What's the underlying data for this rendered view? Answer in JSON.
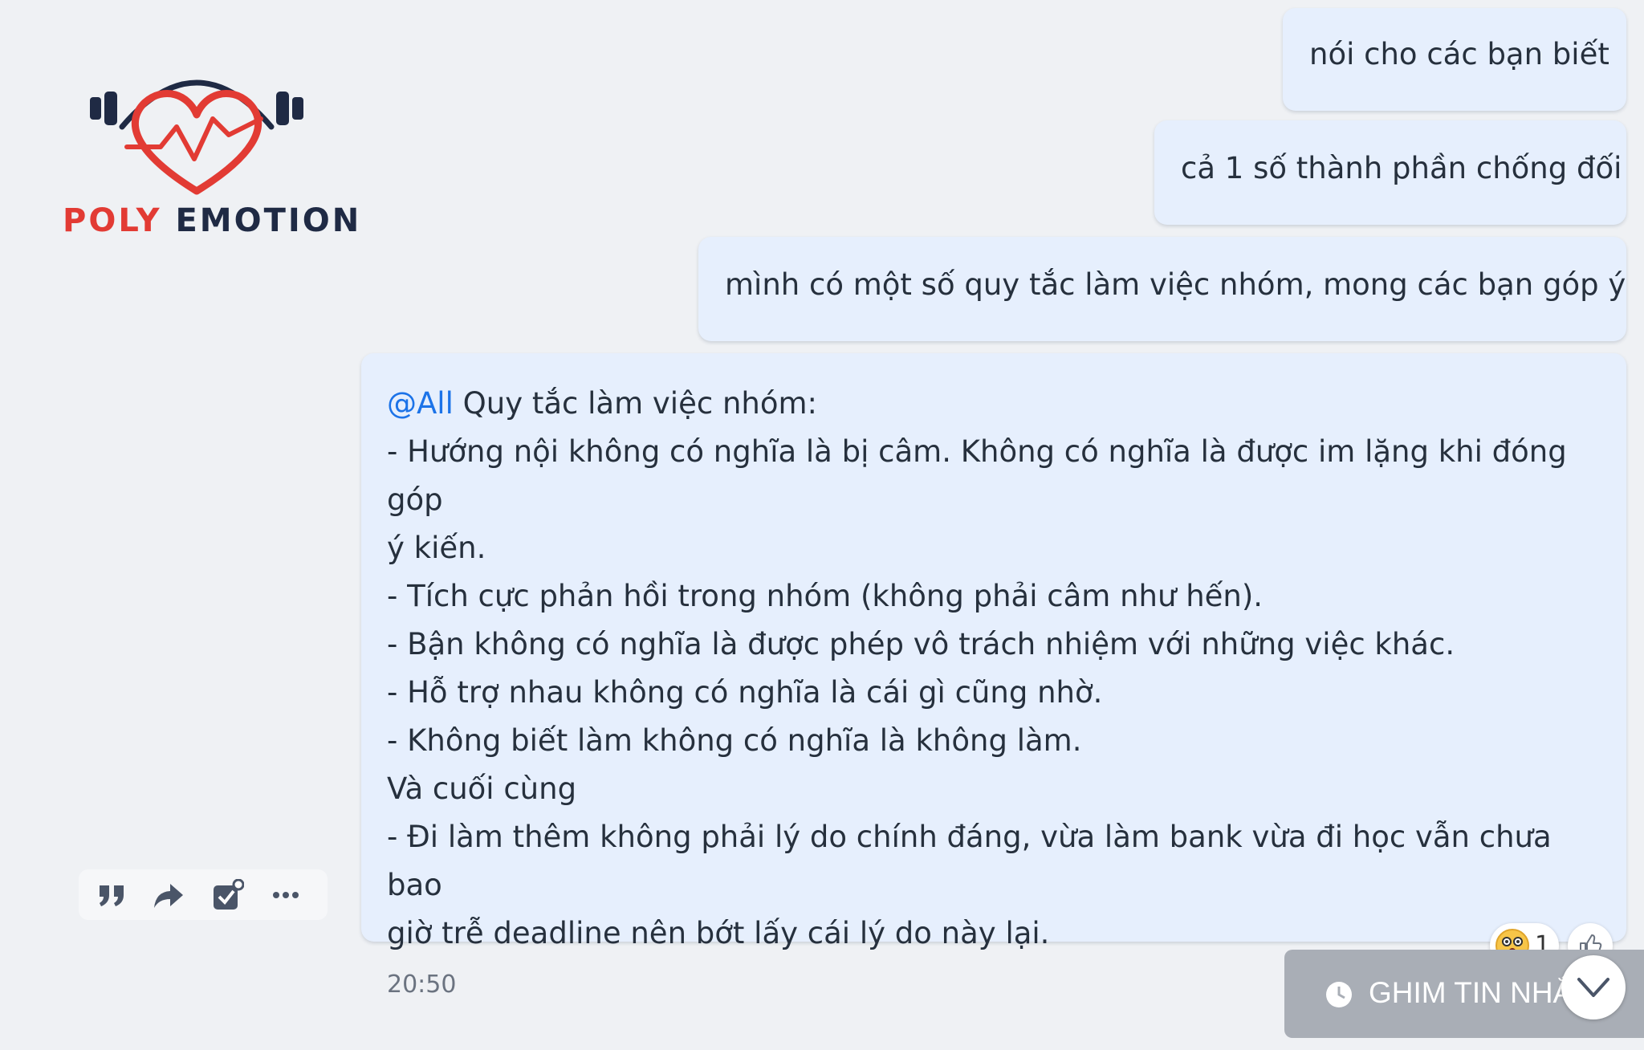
{
  "brand": {
    "word1": "POLY",
    "word2": "EMOTION",
    "accent_color": "#e23b34",
    "dark_color": "#1f2a44"
  },
  "messages": [
    {
      "text": "nói cho các bạn biết"
    },
    {
      "text": "cả 1 số thành phần chống đối"
    },
    {
      "text": "mình có một số quy tắc làm việc nhóm,  mong các bạn góp ý"
    }
  ],
  "main_message": {
    "mention": "@All",
    "heading": " Quy tắc làm việc nhóm:",
    "lines": [
      "- Hướng nội không có nghĩa là bị câm. Không có nghĩa là được im lặng khi đóng góp",
      "ý kiến.",
      "- Tích cực phản hồi trong nhóm (không phải câm như hến).",
      "- Bận không có nghĩa là được phép vô trách nhiệm với những việc khác.",
      "- Hỗ trợ nhau không có nghĩa là cái gì cũng nhờ.",
      "- Không biết làm không có nghĩa là không làm.",
      "Và cuối cùng",
      "- Đi làm thêm không phải lý do chính đáng, vừa làm bank vừa đi học vẫn chưa bao",
      "giờ trễ deadline nên bớt lấy cái lý do này lại."
    ],
    "time": "20:50"
  },
  "message_actions": [
    {
      "icon": "quote-icon"
    },
    {
      "icon": "forward-icon"
    },
    {
      "icon": "create-task-icon"
    },
    {
      "icon": "more-icon"
    }
  ],
  "reaction": {
    "icon": "astonished-face-icon",
    "count": "1"
  },
  "like_icon": "thumbs-up-icon",
  "pin_bar": {
    "icon": "clock-icon",
    "label": "GHIM TIN NHẮN"
  },
  "scroll_down_icon": "chevron-down-icon",
  "colors": {
    "background": "#eff1f4",
    "bubble": "#e6effd",
    "mention": "#1c73e8",
    "pin_bar": "#a9aeb6"
  }
}
